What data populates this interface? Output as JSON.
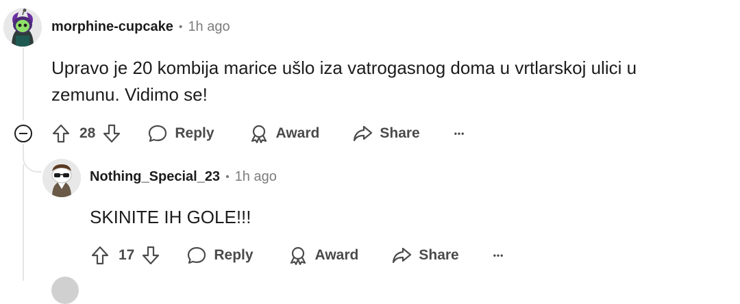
{
  "comments": [
    {
      "author": "morphine-cupcake",
      "separator": "•",
      "time": "1h ago",
      "text": "Upravo je 20 kombija marice ušlo iza vatrogasnog doma u vrtlarskoj ulici u zemunu. Vidimo se!",
      "votes": "28",
      "reply_label": "Reply",
      "award_label": "Award",
      "share_label": "Share",
      "more_label": "•••"
    },
    {
      "author": "Nothing_Special_23",
      "separator": "•",
      "time": "1h ago",
      "text": "SKINITE IH GOLE!!!",
      "votes": "17",
      "reply_label": "Reply",
      "award_label": "Award",
      "share_label": "Share",
      "more_label": "•••"
    }
  ],
  "colors": {
    "text": "#1c1c1c",
    "muted": "#7c7c7c",
    "action": "#4a4a4a",
    "thread": "#e5e5e5"
  }
}
